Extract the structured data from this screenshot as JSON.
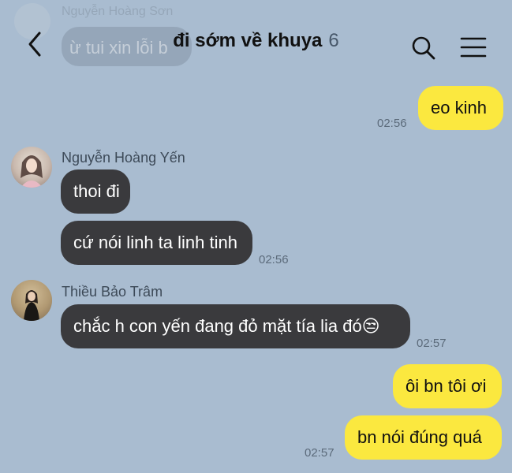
{
  "header": {
    "title": "đi sớm về khuya",
    "member_count": "6",
    "back_icon": "chevron-left-icon",
    "search_icon": "search-icon",
    "menu_icon": "hamburger-menu-icon"
  },
  "overlay_message": {
    "sender": "Nguyễn Hoàng Sơn",
    "text": "ừ tui xin lỗi b"
  },
  "messages": [
    {
      "from": "me",
      "text": "eo kinh",
      "time": "02:56"
    },
    {
      "from": "Nguyễn Hoàng Yến",
      "text": "thoi đi",
      "time": ""
    },
    {
      "from": "Nguyễn Hoàng Yến",
      "text": "cứ nói linh ta linh tinh",
      "time": "02:56"
    },
    {
      "from": "Thiều Bảo Trâm",
      "text": "chắc h con yến đang đỏ mặt tía lia đó😒",
      "time": "02:57"
    },
    {
      "from": "me",
      "text": "ôi bn tôi ơi",
      "time": ""
    },
    {
      "from": "me",
      "text": "bn nói đúng quá",
      "time": "02:57"
    }
  ],
  "senders": {
    "yen": "Nguyễn Hoàng Yến",
    "tram": "Thiều Bảo Trâm"
  },
  "colors": {
    "background": "#a9bcd0",
    "my_bubble": "#fbe83f",
    "their_bubble": "#3a3a3d"
  }
}
